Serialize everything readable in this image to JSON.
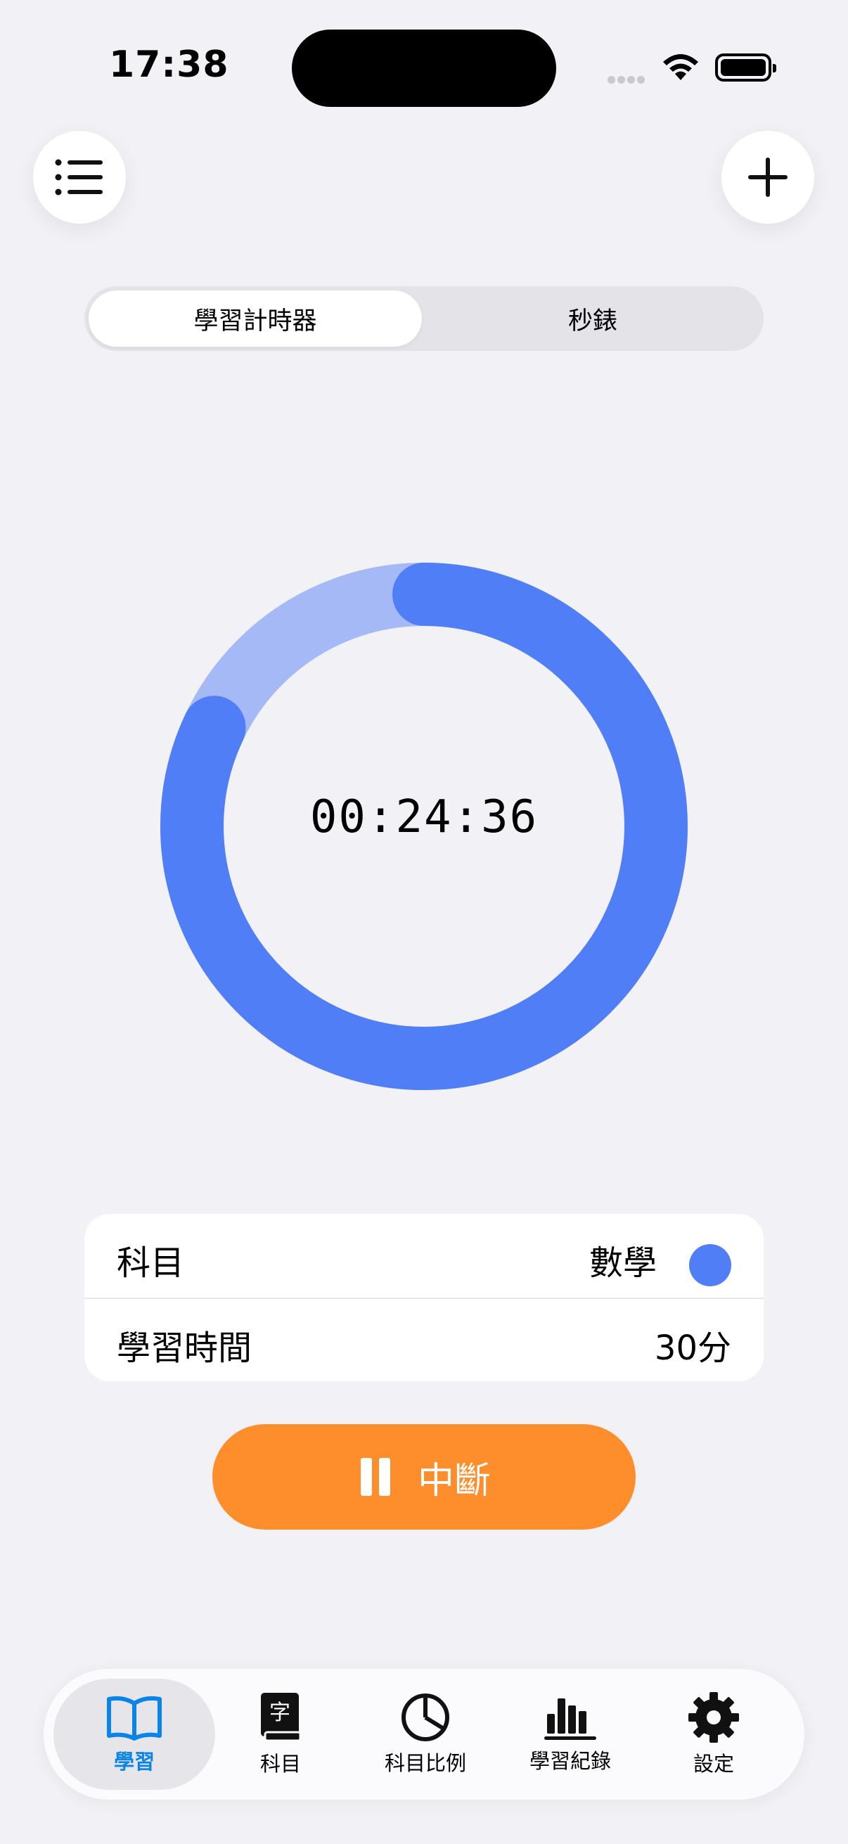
{
  "status_bar": {
    "time": "17:38"
  },
  "segmented": {
    "items": [
      "學習計時器",
      "秒錶"
    ],
    "selected": 0
  },
  "timer": {
    "display": "00:24:36",
    "progress": 0.82,
    "ring_color": "#507EF6",
    "track_color": "#A5B9F7"
  },
  "settings": {
    "subject_label": "科目",
    "subject_value": "數學",
    "subject_color": "#507EF6",
    "duration_label": "學習時間",
    "duration_value": "30分"
  },
  "action": {
    "label": "中斷",
    "color": "#FE8E2C"
  },
  "tabbar": {
    "items": [
      {
        "label": "學習",
        "icon": "book-icon",
        "active": true
      },
      {
        "label": "科目",
        "icon": "dictionary-icon",
        "active": false
      },
      {
        "label": "科目比例",
        "icon": "pie-chart-icon",
        "active": false
      },
      {
        "label": "學習紀錄",
        "icon": "bar-chart-icon",
        "active": false
      },
      {
        "label": "設定",
        "icon": "gear-icon",
        "active": false
      }
    ],
    "active_color": "#0A84E6"
  }
}
